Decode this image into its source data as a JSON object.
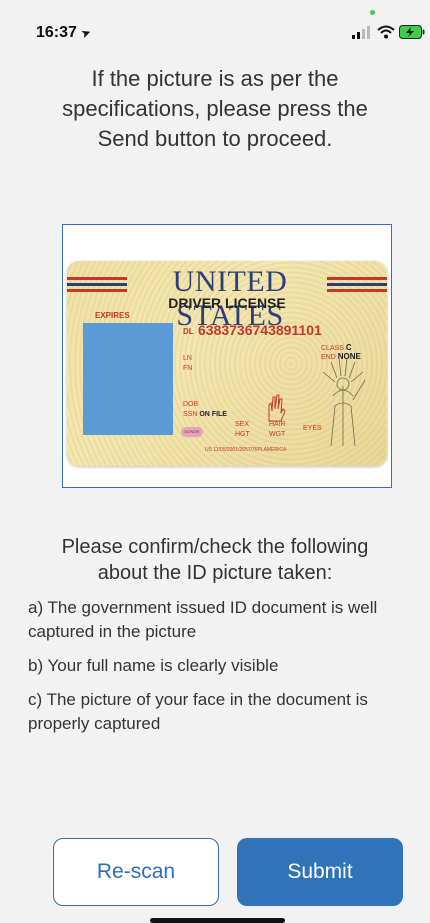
{
  "status_bar": {
    "time": "16:37",
    "icons": [
      "location-arrow-icon",
      "signal-icon",
      "wifi-icon",
      "battery-charging-icon"
    ],
    "battery_color": "#3ecf4a"
  },
  "intro_text": "If the picture is as per the specifications, please press the Send button to proceed.",
  "id_card": {
    "title": "UNITED STATES",
    "subtitle": "DRIVER LICENSE",
    "expires_label": "EXPIRES",
    "dl_label": "DL",
    "dl_number": "6383736743891101",
    "class_label": "CLASS",
    "class_value": "C",
    "end_label": "END",
    "end_value": "NONE",
    "ln_label": "LN",
    "fn_label": "FN",
    "dob_label": "DOB",
    "ssn_label": "SSN",
    "ssn_value": "ON FILE",
    "donor_label": "DONOR",
    "sex_label": "SEX",
    "hgt_label": "HGT",
    "hair_label": "HAIR",
    "wgt_label": "WGT",
    "eyes_label": "EYES",
    "bottom_code": "US 11/05/2001/2657/76PLAMERICA",
    "frame_color": "#3a6fb8",
    "photo_color": "#5b9ad4"
  },
  "confirm_title": "Please confirm/check the following about the ID picture taken:",
  "checklist": [
    "a) The government issued ID document is well captured in the picture",
    "b) Your full name is clearly visible",
    "c) The picture of your face in the document is properly captured"
  ],
  "buttons": {
    "rescan_label": "Re-scan",
    "submit_label": "Submit",
    "accent_color": "#2f73b9"
  }
}
